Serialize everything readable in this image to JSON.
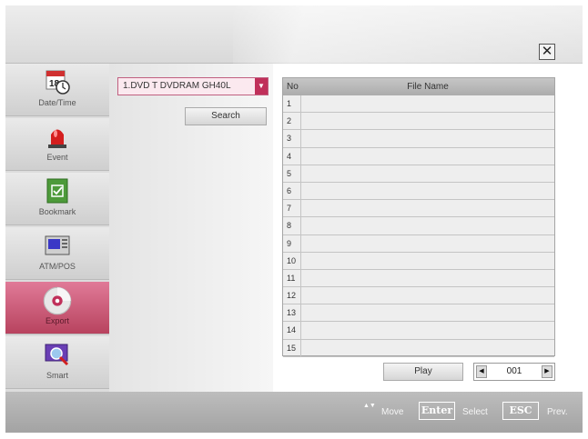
{
  "window": {
    "close_label": "✕"
  },
  "sidebar": {
    "items": [
      {
        "label": "Date/Time",
        "icon": "calendar-clock-icon",
        "active": false
      },
      {
        "label": "Event",
        "icon": "alarm-light-icon",
        "active": false
      },
      {
        "label": "Bookmark",
        "icon": "bookmark-check-icon",
        "active": false
      },
      {
        "label": "ATM/POS",
        "icon": "atm-pos-icon",
        "active": false
      },
      {
        "label": "Export",
        "icon": "disc-icon",
        "active": true
      },
      {
        "label": "Smart",
        "icon": "smart-search-icon",
        "active": false
      }
    ],
    "calendar_day": "18"
  },
  "device": {
    "selected": "1.DVD T DVDRAM GH40L",
    "arrow": "▼"
  },
  "search": {
    "label": "Search"
  },
  "table": {
    "headers": {
      "no": "No",
      "file_name": "File Name"
    },
    "rows": [
      {
        "no": "1",
        "name": ""
      },
      {
        "no": "2",
        "name": ""
      },
      {
        "no": "3",
        "name": ""
      },
      {
        "no": "4",
        "name": ""
      },
      {
        "no": "5",
        "name": ""
      },
      {
        "no": "6",
        "name": ""
      },
      {
        "no": "7",
        "name": ""
      },
      {
        "no": "8",
        "name": ""
      },
      {
        "no": "9",
        "name": ""
      },
      {
        "no": "10",
        "name": ""
      },
      {
        "no": "11",
        "name": ""
      },
      {
        "no": "12",
        "name": ""
      },
      {
        "no": "13",
        "name": ""
      },
      {
        "no": "14",
        "name": ""
      },
      {
        "no": "15",
        "name": ""
      }
    ]
  },
  "controls": {
    "play_label": "Play",
    "page_value": "001",
    "prev_arrow": "◀",
    "next_arrow": "▶"
  },
  "footer": {
    "move_icon": "▲▼",
    "move_label": "Move",
    "enter_key": "Enter",
    "select_label": "Select",
    "esc_key": "ESC",
    "prev_label": "Prev."
  },
  "colors": {
    "accent": "#c0305a",
    "active_tab": "#c8506d",
    "panel": "#e4e4e4"
  }
}
